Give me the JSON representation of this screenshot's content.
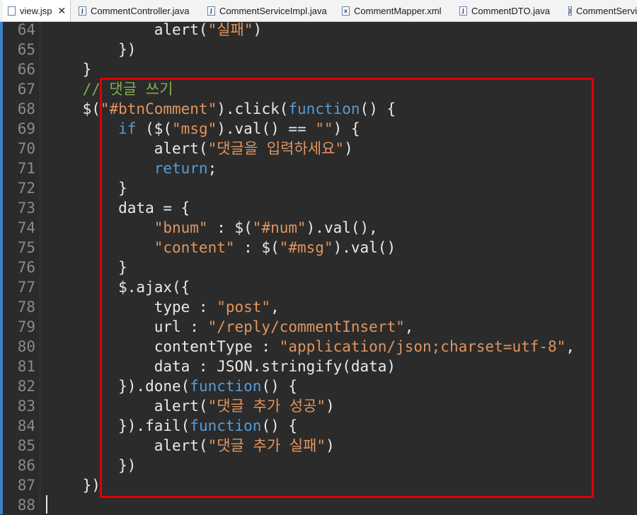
{
  "tabs": [
    {
      "label": "view.jsp",
      "icon": "jsp-file-icon",
      "active": true
    },
    {
      "label": "CommentController.java",
      "icon": "java-file-icon"
    },
    {
      "label": "CommentServiceImpl.java",
      "icon": "java-file-icon"
    },
    {
      "label": "CommentMapper.xml",
      "icon": "xml-file-icon"
    },
    {
      "label": "CommentDTO.java",
      "icon": "java-file-icon"
    },
    {
      "label": "CommentService",
      "icon": "java-file-icon"
    }
  ],
  "close_glyph": "✕",
  "colors": {
    "background": "#2b2b2b",
    "keyword": "#569cd6",
    "string": "#e0955f",
    "comment": "#7fb24f",
    "text": "#eaeaea",
    "line_number": "#8a8a8a",
    "highlight_box": "#e00000"
  },
  "code_lines": [
    {
      "n": "64",
      "segs": [
        {
          "t": "            alert("
        },
        {
          "t": "\"실패\"",
          "c": "str"
        },
        {
          "t": ")"
        }
      ]
    },
    {
      "n": "65",
      "segs": [
        {
          "t": "        })"
        }
      ]
    },
    {
      "n": "66",
      "segs": [
        {
          "t": "    }"
        }
      ]
    },
    {
      "n": "67",
      "segs": [
        {
          "t": "    "
        },
        {
          "t": "// 댓글 쓰기",
          "c": "cm"
        }
      ]
    },
    {
      "n": "68",
      "segs": [
        {
          "t": "    $("
        },
        {
          "t": "\"#btnComment\"",
          "c": "str"
        },
        {
          "t": ").click("
        },
        {
          "t": "function",
          "c": "kw"
        },
        {
          "t": "() {"
        }
      ]
    },
    {
      "n": "69",
      "segs": [
        {
          "t": "        "
        },
        {
          "t": "if",
          "c": "kw"
        },
        {
          "t": " ($("
        },
        {
          "t": "\"msg\"",
          "c": "str"
        },
        {
          "t": ").val() == "
        },
        {
          "t": "\"\"",
          "c": "str"
        },
        {
          "t": ") {"
        }
      ]
    },
    {
      "n": "70",
      "segs": [
        {
          "t": "            alert("
        },
        {
          "t": "\"댓글을 입력하세요\"",
          "c": "str"
        },
        {
          "t": ")"
        }
      ]
    },
    {
      "n": "71",
      "segs": [
        {
          "t": "            "
        },
        {
          "t": "return",
          "c": "kw"
        },
        {
          "t": ";"
        }
      ]
    },
    {
      "n": "72",
      "segs": [
        {
          "t": "        }"
        }
      ]
    },
    {
      "n": "73",
      "segs": [
        {
          "t": "        data = {"
        }
      ]
    },
    {
      "n": "74",
      "segs": [
        {
          "t": "            "
        },
        {
          "t": "\"bnum\"",
          "c": "str"
        },
        {
          "t": " : $("
        },
        {
          "t": "\"#num\"",
          "c": "str"
        },
        {
          "t": ").val(),"
        }
      ]
    },
    {
      "n": "75",
      "segs": [
        {
          "t": "            "
        },
        {
          "t": "\"content\"",
          "c": "str"
        },
        {
          "t": " : $("
        },
        {
          "t": "\"#msg\"",
          "c": "str"
        },
        {
          "t": ").val()"
        }
      ]
    },
    {
      "n": "76",
      "segs": [
        {
          "t": "        }"
        }
      ]
    },
    {
      "n": "77",
      "segs": [
        {
          "t": "        $.ajax({"
        }
      ]
    },
    {
      "n": "78",
      "segs": [
        {
          "t": "            type : "
        },
        {
          "t": "\"post\"",
          "c": "str"
        },
        {
          "t": ","
        }
      ]
    },
    {
      "n": "79",
      "segs": [
        {
          "t": "            url : "
        },
        {
          "t": "\"/reply/commentInsert\"",
          "c": "str"
        },
        {
          "t": ","
        }
      ]
    },
    {
      "n": "80",
      "segs": [
        {
          "t": "            contentType : "
        },
        {
          "t": "\"application/json;charset=utf-8\"",
          "c": "str"
        },
        {
          "t": ","
        }
      ]
    },
    {
      "n": "81",
      "segs": [
        {
          "t": "            data : JSON.stringify(data)"
        }
      ]
    },
    {
      "n": "82",
      "segs": [
        {
          "t": "        }).done("
        },
        {
          "t": "function",
          "c": "kw"
        },
        {
          "t": "() {"
        }
      ]
    },
    {
      "n": "83",
      "segs": [
        {
          "t": "            alert("
        },
        {
          "t": "\"댓글 추가 성공\"",
          "c": "str"
        },
        {
          "t": ")"
        }
      ]
    },
    {
      "n": "84",
      "segs": [
        {
          "t": "        }).fail("
        },
        {
          "t": "function",
          "c": "kw"
        },
        {
          "t": "() {"
        }
      ]
    },
    {
      "n": "85",
      "segs": [
        {
          "t": "            alert("
        },
        {
          "t": "\"댓글 추가 실패\"",
          "c": "str"
        },
        {
          "t": ")"
        }
      ]
    },
    {
      "n": "86",
      "segs": [
        {
          "t": "        })"
        }
      ]
    },
    {
      "n": "87",
      "segs": [
        {
          "t": "    })"
        }
      ]
    },
    {
      "n": "88",
      "segs": []
    }
  ]
}
